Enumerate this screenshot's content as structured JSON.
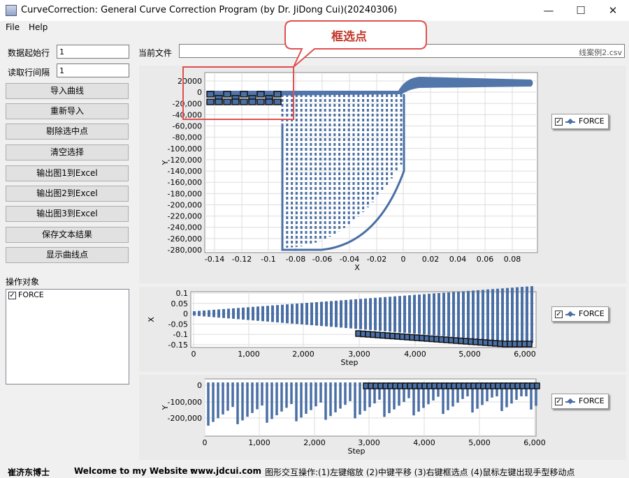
{
  "window": {
    "title": "CurveCorrection: General Curve Correction Program (by Dr. JiDong Cui)(20240306)",
    "minimize": "—",
    "maximize": "☐",
    "close": "✕"
  },
  "menu": [
    "File",
    "Help"
  ],
  "left": {
    "start_row_label": "数据起始行",
    "start_row_value": "1",
    "interval_label": "读取行间隔",
    "interval_value": "1",
    "buttons": [
      "导入曲线",
      "重新导入",
      "剔除选中点",
      "清空选择",
      "输出图1到Excel",
      "输出图2到Excel",
      "输出图3到Excel",
      "保存文本结果",
      "显示曲线点"
    ],
    "objects_label": "操作对象",
    "objects": [
      "FORCE"
    ]
  },
  "file": {
    "label": "当前文件",
    "value": "线案例2.csv"
  },
  "callout": "框选点",
  "charts": {
    "legend_name": "FORCE",
    "chart1": {
      "ylabel": "Y",
      "xlabel": "X",
      "yticks": [
        "20000",
        "0",
        "-20,000",
        "-40,000",
        "-60,000",
        "-80,000",
        "-100,000",
        "-120,000",
        "-140,000",
        "-160,000",
        "-180,000",
        "-200,000",
        "-220,000",
        "-240,000",
        "-260,000",
        "-280,000"
      ],
      "xticks": [
        "-0.14",
        "-0.12",
        "-0.1",
        "-0.08",
        "-0.06",
        "-0.04",
        "-0.02",
        "0",
        "0.02",
        "0.04",
        "0.06",
        "0.08"
      ]
    },
    "chart2": {
      "ylabel": "X",
      "xlabel": "Step",
      "yticks": [
        "0.1",
        "0.05",
        "0",
        "-0.05",
        "-0.1",
        "-0.15"
      ],
      "xticks": [
        "0",
        "1,000",
        "2,000",
        "3,000",
        "4,000",
        "5,000",
        "6,000"
      ]
    },
    "chart3": {
      "ylabel": "Y",
      "xlabel": "Step",
      "yticks": [
        "0",
        "-100,000",
        "-200,000"
      ],
      "xticks": [
        "0",
        "1,000",
        "2,000",
        "3,000",
        "4,000",
        "5,000",
        "6,000"
      ]
    }
  },
  "status": {
    "author": "崔济东博士",
    "welcome": "Welcome to my Website :",
    "site": "www.jdcui.com",
    "hint": "图形交互操作:(1)左键缩放 (2)中键平移 (3)右键框选点 (4)鼠标左键出现手型移动点"
  },
  "colors": {
    "series": "#4a6fa5",
    "selected": "#111111",
    "callout": "#e05050"
  }
}
